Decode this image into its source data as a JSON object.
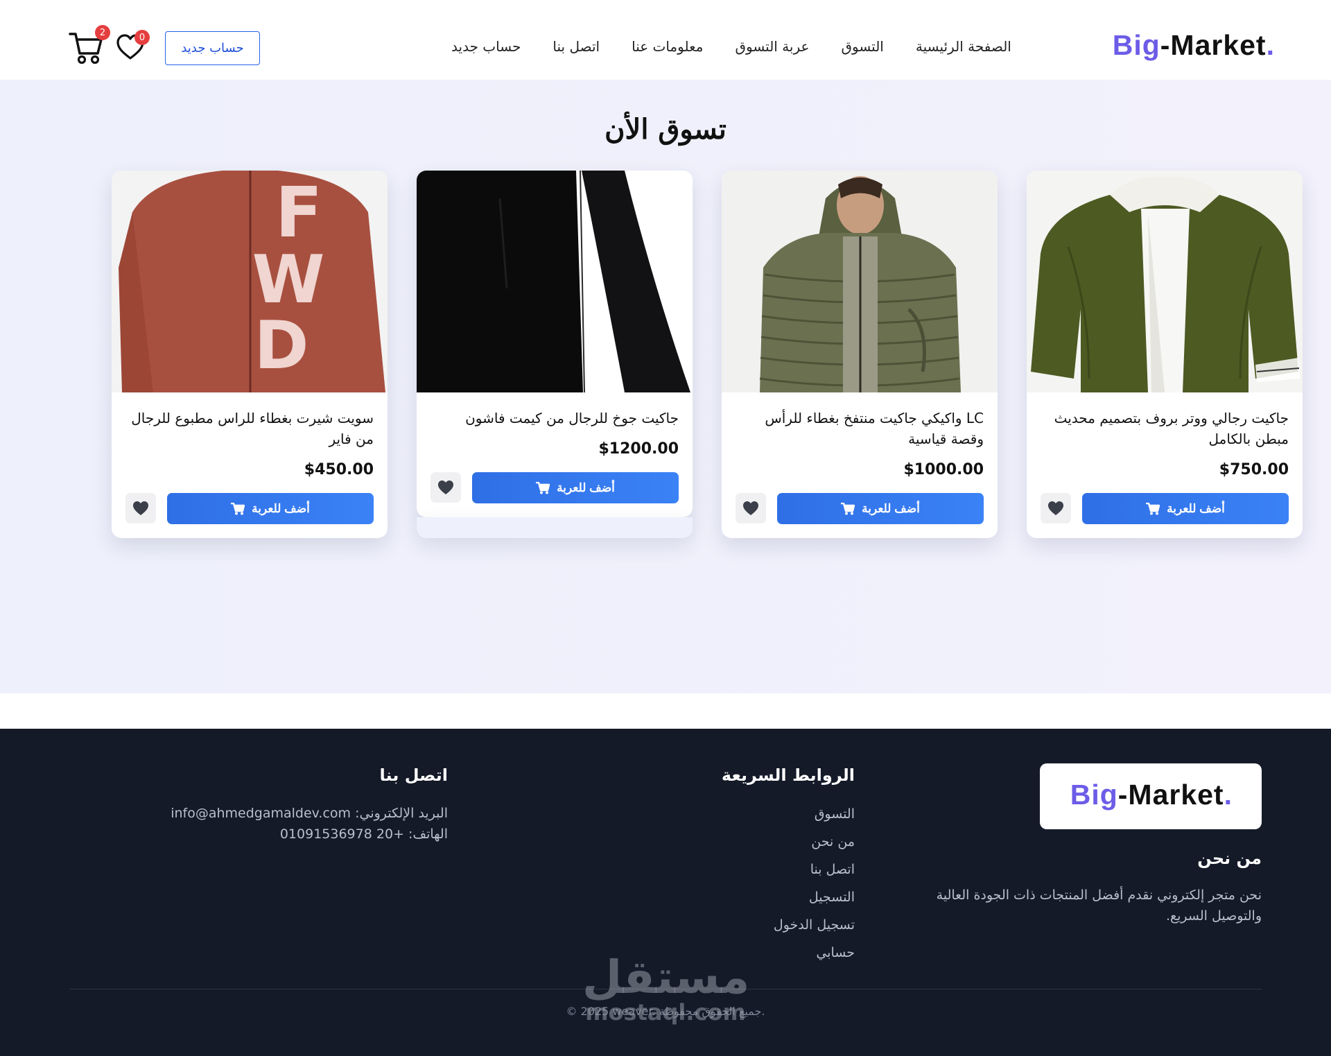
{
  "brand": {
    "part1": "Big",
    "part2": "-Market",
    "dot": "."
  },
  "nav": {
    "links": [
      "الصفحة الرئيسية",
      "التسوق",
      "عربة التسوق",
      "معلومات عنا",
      "اتصل بنا",
      "حساب جديد"
    ],
    "signup_button": "حساب جديد",
    "wishlist_count": "0",
    "cart_count": "2"
  },
  "shop": {
    "title": "تسوق الأن",
    "products": [
      {
        "name": "جاكيت رجالي ووتر بروف بتصميم محديث مبطن بالكامل",
        "price": "$750.00",
        "button": "أضف للعربة",
        "image": "olive-bomber-jacket"
      },
      {
        "name": "LC واكيكي جاكيت منتفخ بغطاء للرأس وقصة قياسية",
        "price": "$1000.00",
        "button": "أضف للعربة",
        "image": "olive-puffer-jacket"
      },
      {
        "name": "جاكيت جوخ للرجال من كيمت فاشون",
        "price": "$1200.00",
        "button": "أضف للعربة",
        "image": "black-wool-coat"
      },
      {
        "name": "سويت شيرت بغطاء للراس مطبوع للرجال من فاير",
        "price": "$450.00",
        "button": "أضف للعربة",
        "image": "red-fwd-hoodie"
      }
    ]
  },
  "footer": {
    "about_title": "من نحن",
    "about_text": "نحن متجر إلكتروني نقدم أفضل المنتجات ذات الجودة العالية والتوصيل السريع.",
    "links_title": "الروابط السريعة",
    "links": [
      "التسوق",
      "من نحن",
      "اتصل بنا",
      "التسجيل",
      "تسجيل الدخول",
      "حسابي"
    ],
    "contact_title": "اتصل بنا",
    "email_line": "البريد الإلكتروني: info@ahmedgamaldev.com",
    "phone_line": "الهاتف: +20 01091536978",
    "copyright": "© 2025 weaver. جميع الحقوق محفوظة."
  },
  "watermark": {
    "arabic": "مستقل",
    "latin": "mostaql.com"
  },
  "colors": {
    "accent": "#6c5ce7",
    "button": "#3b82f6",
    "badge": "#e53e3e",
    "footer_bg": "#141a28"
  }
}
